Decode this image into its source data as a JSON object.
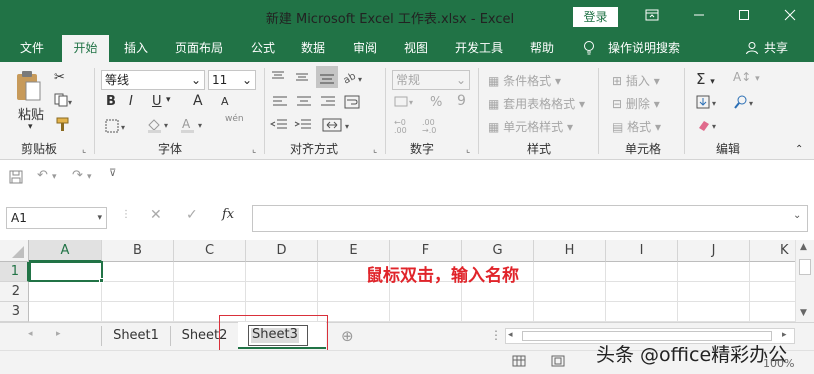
{
  "window": {
    "title": "新建 Microsoft Excel 工作表.xlsx  -  Excel",
    "login_label": "登录",
    "controls": [
      "ribbon-display-icon",
      "minimize-icon",
      "maximize-icon",
      "close-icon"
    ]
  },
  "menu": {
    "items": [
      "文件",
      "开始",
      "插入",
      "页面布局",
      "公式",
      "数据",
      "审阅",
      "视图",
      "开发工具",
      "帮助"
    ],
    "active": "开始",
    "tell_me": "操作说明搜索",
    "share": "共享"
  },
  "ribbon": {
    "clipboard": {
      "label": "剪贴板",
      "paste": "粘贴"
    },
    "font": {
      "label": "字体",
      "font_name": "等线",
      "font_size": "11",
      "bold": "B",
      "italic": "I",
      "underline": "U",
      "grow": "A",
      "shrink": "A",
      "phonetic": "wén"
    },
    "alignment": {
      "label": "对齐方式"
    },
    "number": {
      "label": "数字",
      "format": "常规",
      "percent": "%",
      "comma": "9"
    },
    "styles": {
      "label": "样式",
      "conditional": "条件格式",
      "table": "套用表格格式",
      "cell_styles": "单元格样式"
    },
    "cells": {
      "label": "单元格",
      "insert": "插入",
      "delete": "删除",
      "format": "格式"
    },
    "editing": {
      "label": "编辑"
    }
  },
  "formula_bar": {
    "name_box": "A1",
    "fx": "fx",
    "value": ""
  },
  "sheet": {
    "columns": [
      "A",
      "B",
      "C",
      "D",
      "E",
      "F",
      "G",
      "H",
      "I",
      "J",
      "K"
    ],
    "rows": [
      "1",
      "2",
      "3"
    ],
    "selected_cell": "A1",
    "annotation": "鼠标双击，输入名称"
  },
  "tabs": {
    "sheets": [
      "Sheet1",
      "Sheet2",
      "Sheet3"
    ],
    "active": "Sheet3",
    "editing": "Sheet3"
  },
  "status": {
    "zoom": "100%",
    "watermark": "头条 @office精彩办公"
  },
  "colors": {
    "brand": "#217346",
    "annotation": "#e0242a",
    "highlight": "#d9303a"
  }
}
